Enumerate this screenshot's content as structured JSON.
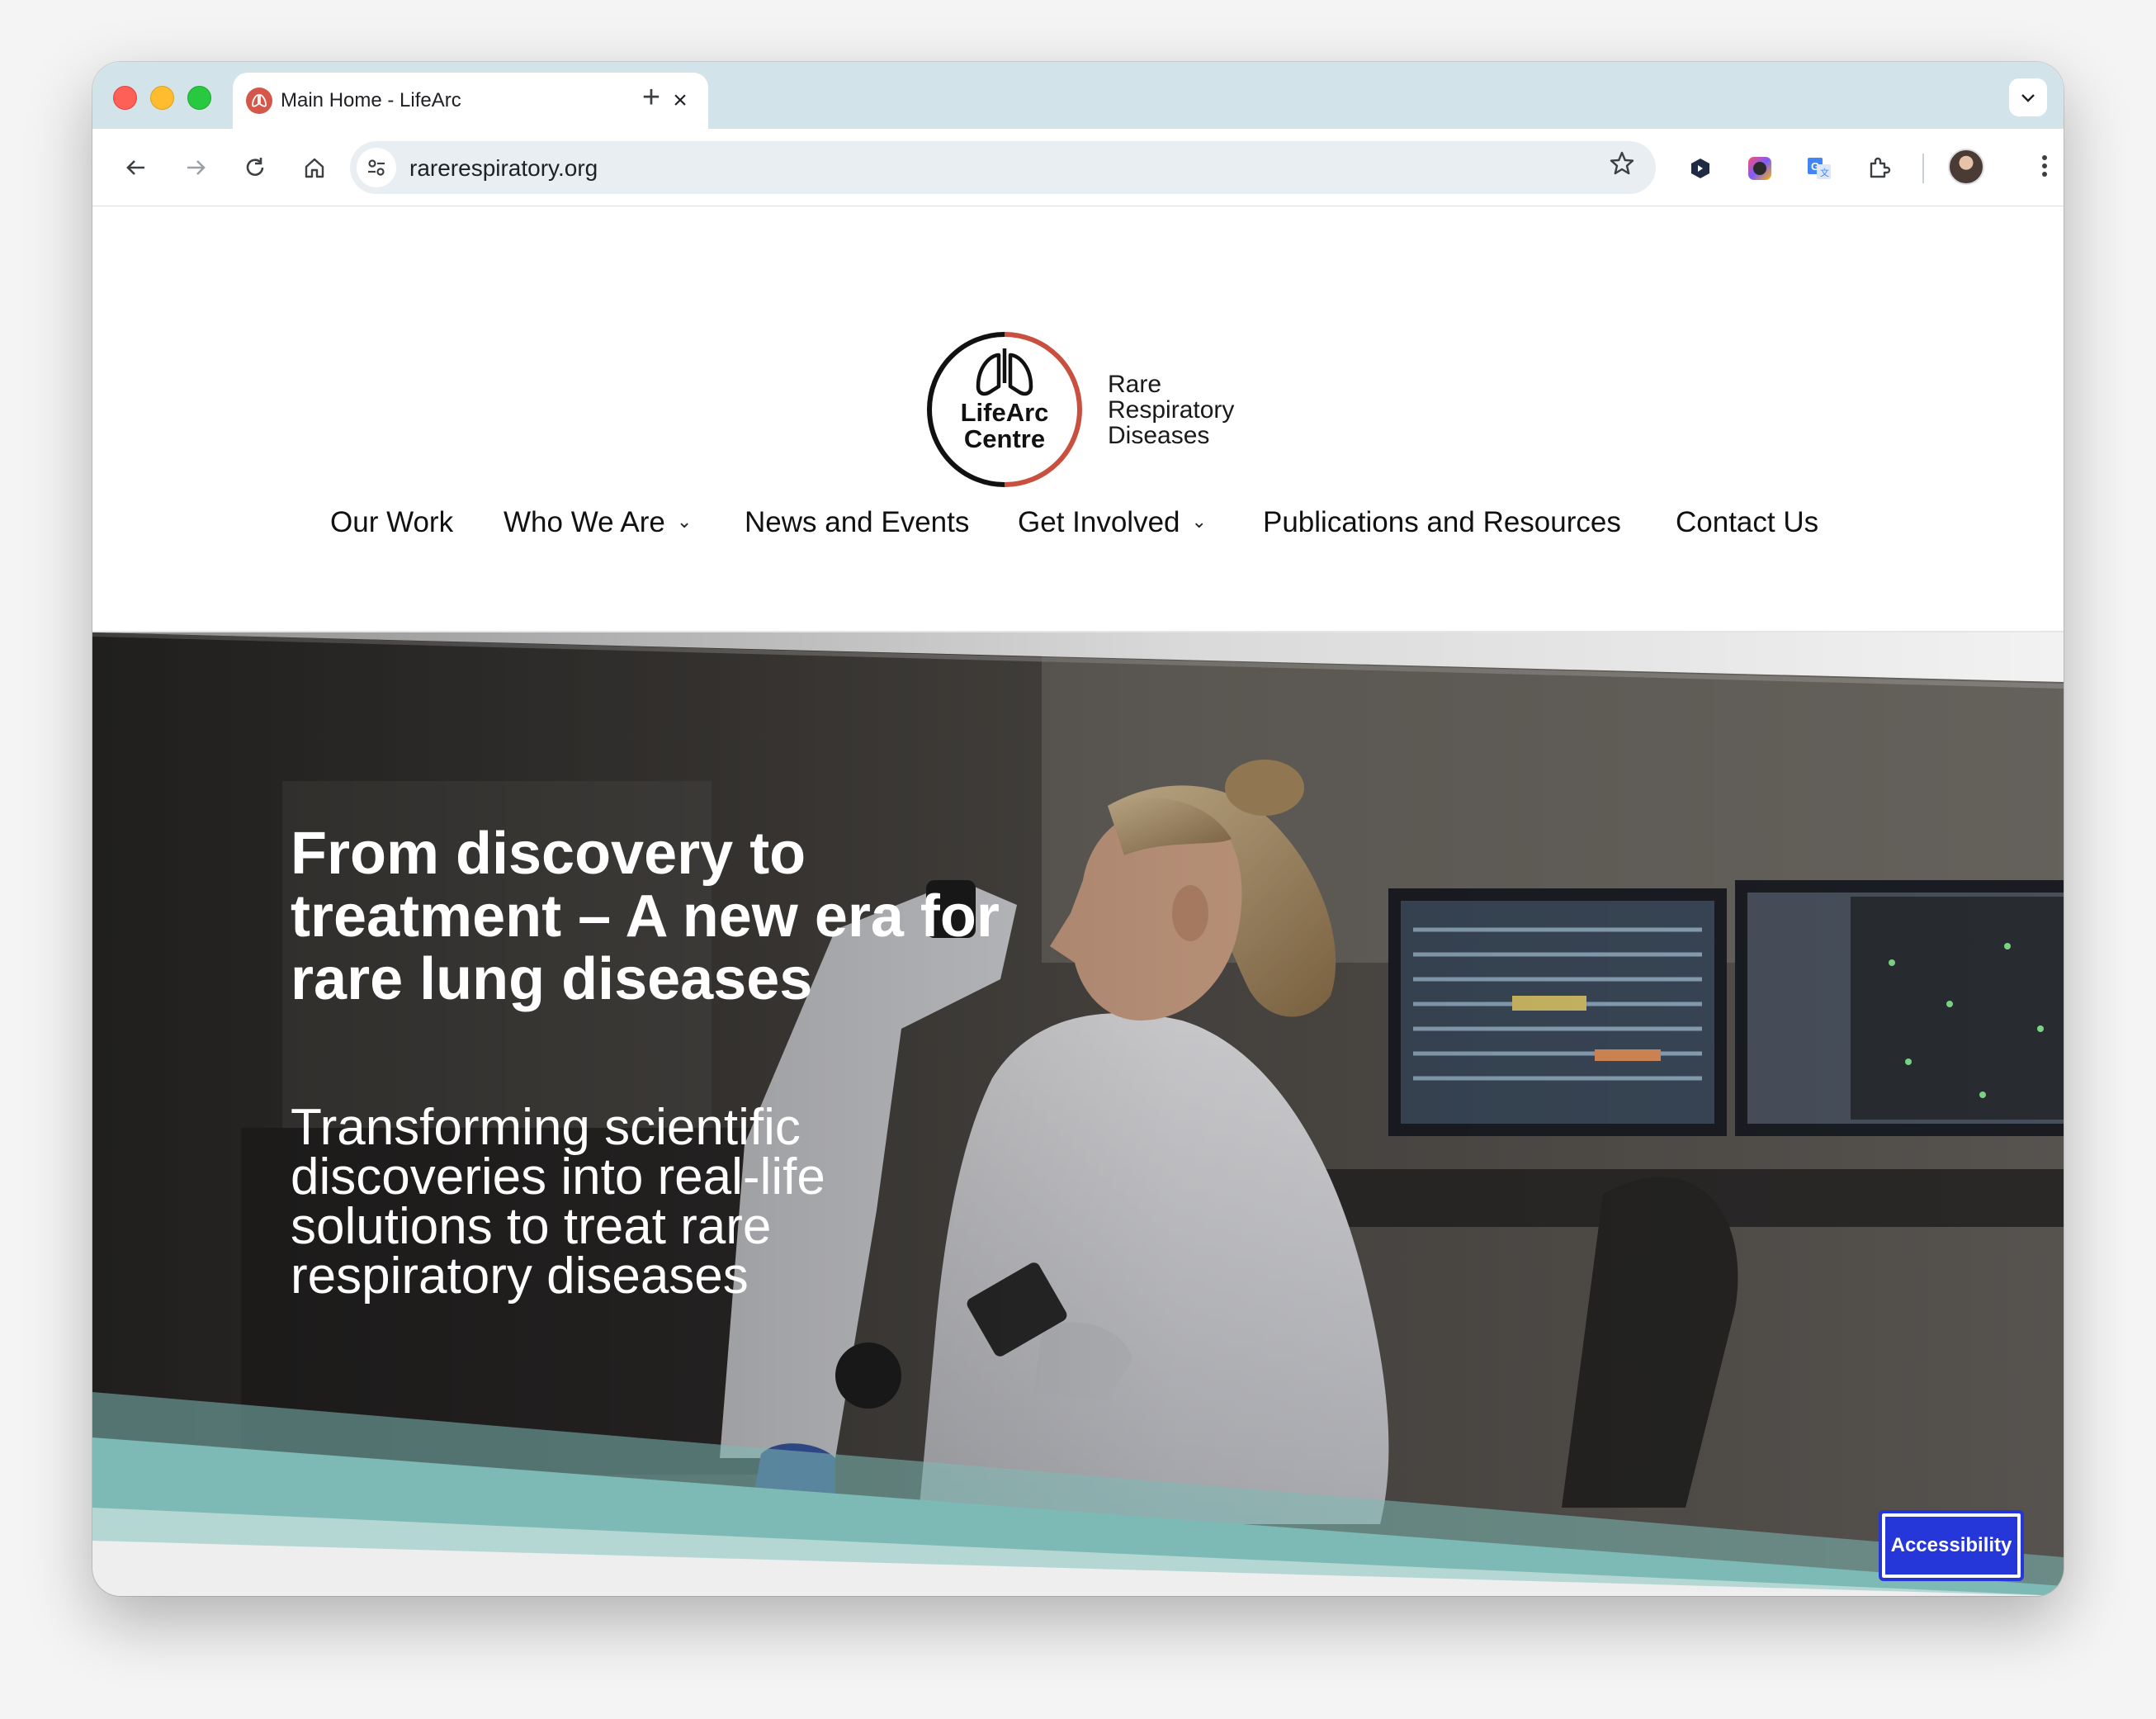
{
  "browser": {
    "tab_title": "Main Home - LifeArc",
    "tab_close": "×",
    "new_tab": "+",
    "url": "rarerespiratory.org",
    "tab_menu": "⌄"
  },
  "site": {
    "logo_inner_line1": "LifeArc",
    "logo_inner_line2": "Centre",
    "logo_side_line1": "Rare",
    "logo_side_line2": "Respiratory",
    "logo_side_line3": "Diseases"
  },
  "nav": {
    "items": [
      {
        "label": "Our Work",
        "has_dropdown": false
      },
      {
        "label": "Who We Are",
        "has_dropdown": true
      },
      {
        "label": "News and Events",
        "has_dropdown": false
      },
      {
        "label": "Get Involved",
        "has_dropdown": true
      },
      {
        "label": "Publications and Resources",
        "has_dropdown": false
      },
      {
        "label": "Contact Us",
        "has_dropdown": false
      }
    ]
  },
  "hero": {
    "title_line1": "From discovery to",
    "title_line2": "treatment – A new era for",
    "title_line3": "rare lung diseases",
    "subtitle_line1": "Transforming scientific",
    "subtitle_line2": "discoveries into real-life",
    "subtitle_line3": "solutions to treat rare",
    "subtitle_line4": "respiratory diseases"
  },
  "accessibility_label": "Accessibility",
  "colors": {
    "teal": "#7dbab5",
    "logo_red": "#c9503f",
    "accessibility_blue": "#2637d9",
    "tabstrip": "#d3e3ea"
  }
}
